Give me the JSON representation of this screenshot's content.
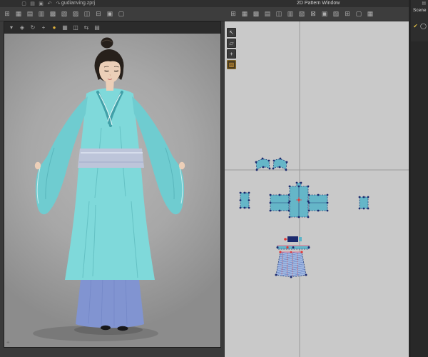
{
  "titlebar": {
    "file_title": "gudianving.zprj",
    "pattern_window_title": "2D Pattern Window",
    "menu_icons": [
      {
        "name": "new-file-icon",
        "glyph": "▢"
      },
      {
        "name": "open-file-icon",
        "glyph": "▤"
      },
      {
        "name": "save-file-icon",
        "glyph": "▣"
      },
      {
        "name": "undo-icon",
        "glyph": "↶"
      },
      {
        "name": "redo-icon",
        "glyph": "↷"
      }
    ]
  },
  "toolbars": {
    "left_icons": [
      {
        "name": "show-avatar-icon",
        "glyph": "⊞"
      },
      {
        "name": "show-garment-icon",
        "glyph": "▦"
      },
      {
        "name": "show-mesh-icon",
        "glyph": "▤"
      },
      {
        "name": "texture-view-icon",
        "glyph": "▥"
      },
      {
        "name": "wireframe-view-icon",
        "glyph": "▩"
      },
      {
        "name": "scene-grid-icon",
        "glyph": "▧"
      },
      {
        "name": "show-pins-icon",
        "glyph": "▨"
      },
      {
        "name": "show-seams-icon",
        "glyph": "◫"
      },
      {
        "name": "show-strain-icon",
        "glyph": "⊟"
      },
      {
        "name": "show-pressure-icon",
        "glyph": "▣"
      },
      {
        "name": "show-gizmo-icon",
        "glyph": "▢"
      }
    ],
    "right_icons": [
      {
        "name": "pattern-outline-icon",
        "glyph": "⊞"
      },
      {
        "name": "grainline-icon",
        "glyph": "▦"
      },
      {
        "name": "seamline-icon",
        "glyph": "▩"
      },
      {
        "name": "notch-icon",
        "glyph": "▤"
      },
      {
        "name": "baseline-icon",
        "glyph": "◫"
      },
      {
        "name": "grid-snap-icon",
        "glyph": "▥"
      },
      {
        "name": "show-sewing-icon",
        "glyph": "▧"
      },
      {
        "name": "texture-2d-icon",
        "glyph": "⊠"
      },
      {
        "name": "pattern-mesh-icon",
        "glyph": "▣"
      },
      {
        "name": "annotation-icon",
        "glyph": "▨"
      },
      {
        "name": "ruler-icon",
        "glyph": "⊞"
      },
      {
        "name": "layout-icon",
        "glyph": "▢"
      },
      {
        "name": "sync-icon",
        "glyph": "▦"
      }
    ],
    "far_icons": [
      {
        "name": "panel-toggle-icon",
        "glyph": "▤"
      }
    ]
  },
  "viewport3d": {
    "toolbar_icons": [
      {
        "name": "menu-dropdown-icon",
        "glyph": "▾"
      },
      {
        "name": "move-gizmo-icon",
        "glyph": "◈"
      },
      {
        "name": "rotate-gizmo-icon",
        "glyph": "↻"
      },
      {
        "name": "scale-gizmo-icon",
        "glyph": "+"
      },
      {
        "name": "simulate-icon",
        "glyph": "●",
        "color": "#e0b23c"
      },
      {
        "name": "display-mode-icon",
        "glyph": "▦"
      },
      {
        "name": "camera-view-icon",
        "glyph": "◫"
      },
      {
        "name": "snap-icon",
        "glyph": "⇆"
      },
      {
        "name": "render-icon",
        "glyph": "▤"
      }
    ],
    "corner_icon": {
      "name": "view-axis-icon",
      "glyph": "⌖"
    }
  },
  "pattern2d": {
    "side_tools": [
      {
        "name": "transform-pattern-tool-icon",
        "glyph": "↖"
      },
      {
        "name": "edit-pattern-tool-icon",
        "glyph": "▱"
      },
      {
        "name": "add-point-tool-icon",
        "glyph": "+"
      },
      {
        "name": "edit-sewing-tool-icon",
        "glyph": "▨",
        "color": "#e2a23a",
        "active": true
      }
    ]
  },
  "scene_panel": {
    "title": "Scene",
    "top_icon": {
      "name": "panel-menu-icon",
      "glyph": "▤"
    },
    "items": [
      {
        "name": "visibility-check-icon",
        "glyph": "✔",
        "color": "#d8b844"
      },
      {
        "name": "avatar-circle-icon",
        "glyph": "◯",
        "color": "#c8c8c8"
      }
    ]
  },
  "colors": {
    "app_bg": "#3a3a3a",
    "titlebar_bg": "#2f2f2f",
    "toolbar_bg": "#3d3d3d",
    "viewport_frame": "#262626",
    "pattern_bg": "#c9c9c9",
    "axis": "#9c9c9c",
    "piece_fill": "#5cb4c8",
    "piece_stroke": "#24407a",
    "point": "#1b2a6e",
    "seam_red": "#e03838",
    "hatch_base": "#9fb9e4",
    "hatch_line": "#4a66b8",
    "robe": "#7fd9da",
    "robe_shade": "#6fccd0",
    "underskirt": "#8194d1",
    "sash": "#bdc5da",
    "skin": "#eccfb8",
    "hair": "#27201b",
    "accent_yellow": "#e0b23c"
  }
}
